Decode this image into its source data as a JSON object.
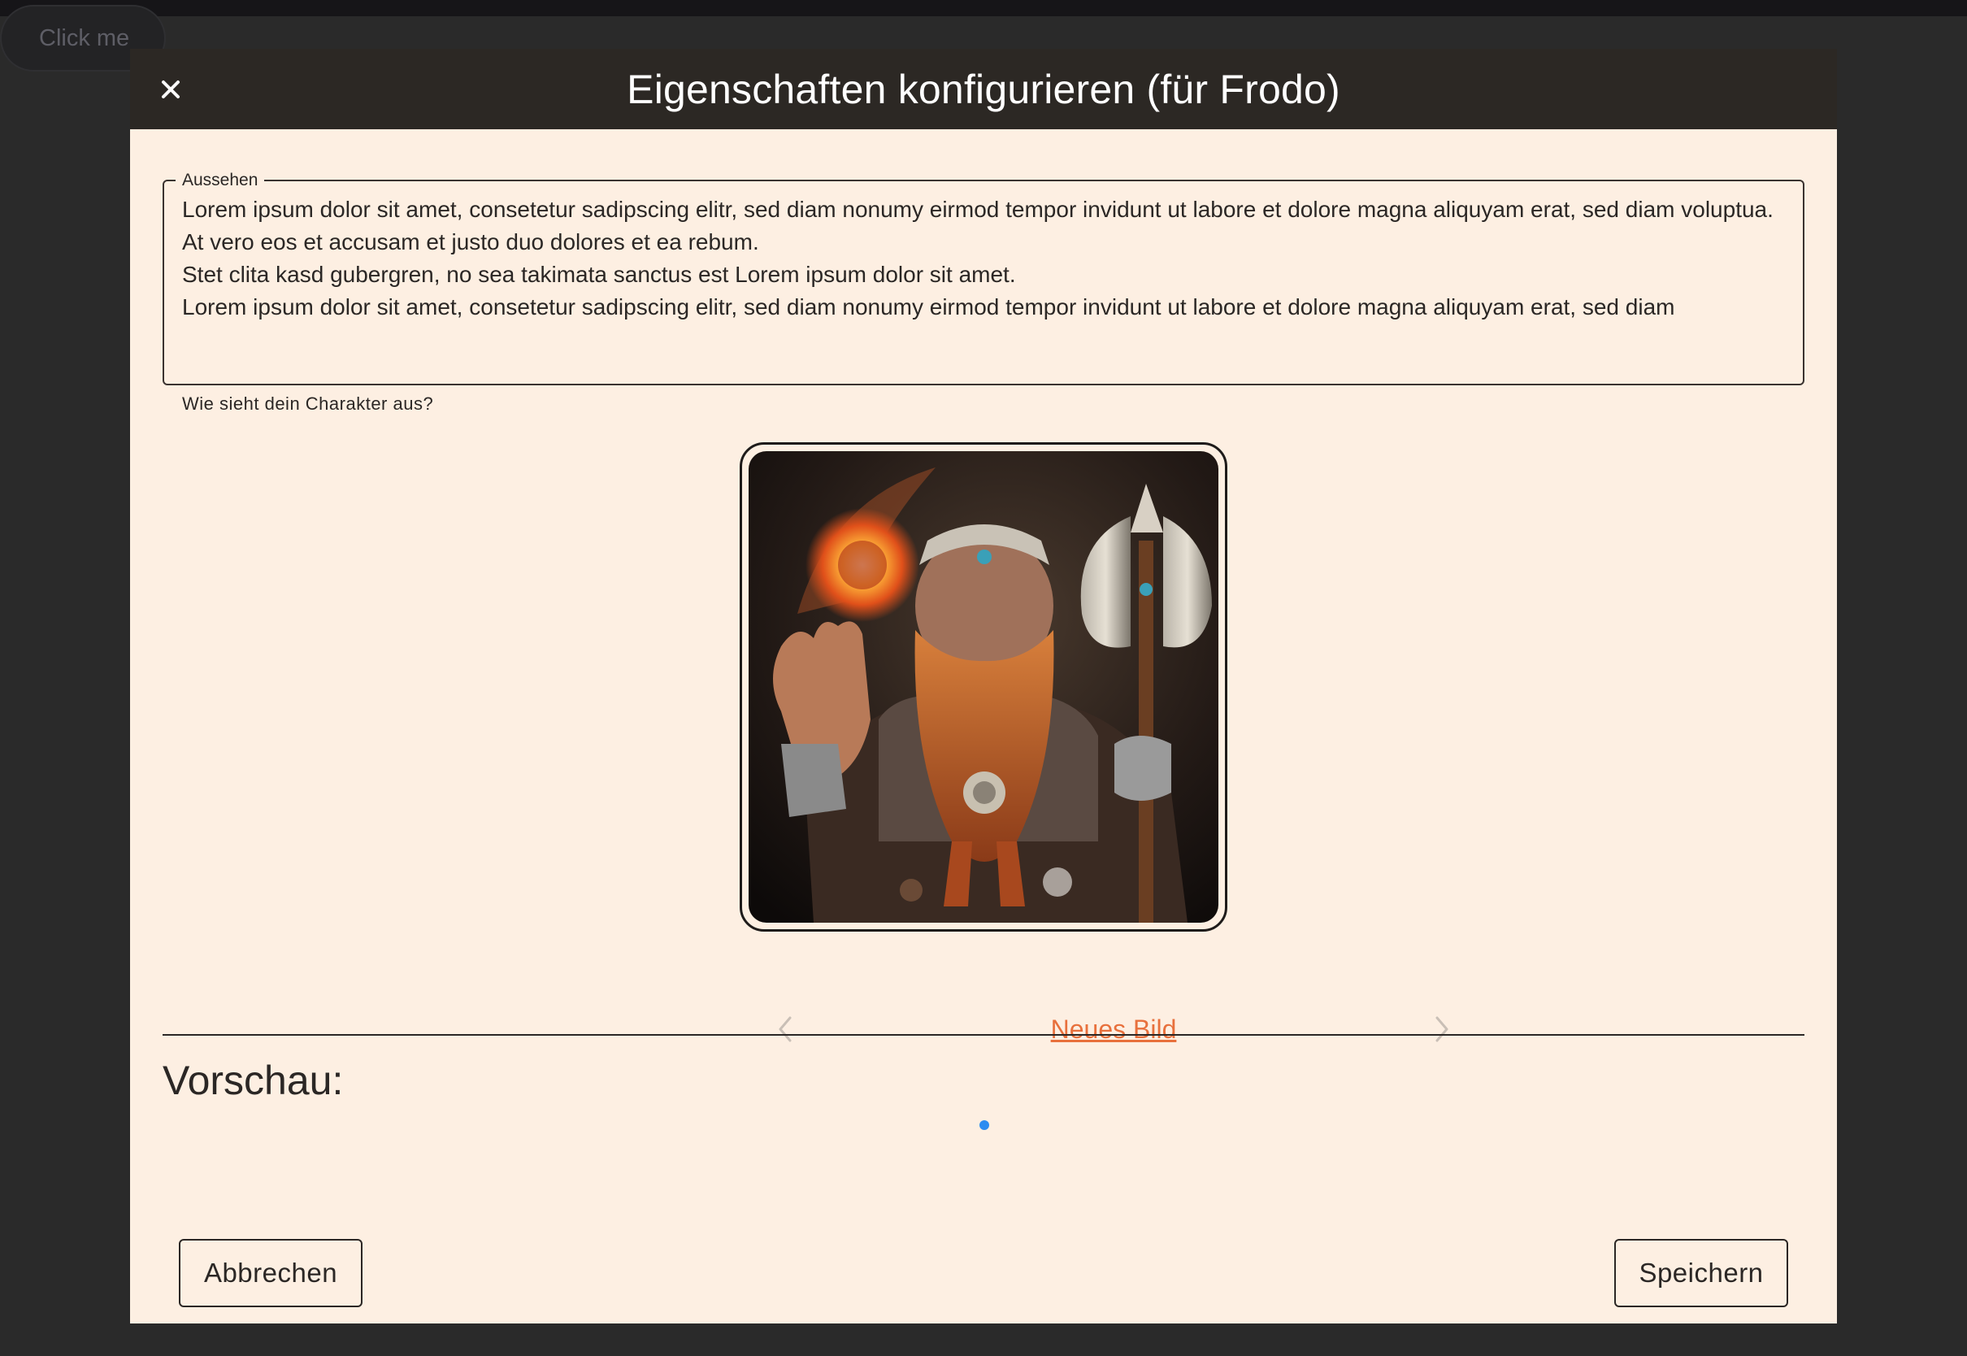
{
  "background": {
    "button_label": "Click me"
  },
  "dialog": {
    "title": "Eigenschaften konfigurieren (für Frodo)",
    "close_symbol": "×",
    "appearance_field": {
      "legend": "Aussehen",
      "value": "Lorem ipsum dolor sit amet, consetetur sadipscing elitr, sed diam nonumy eirmod tempor invidunt ut labore et dolore magna aliquyam erat, sed diam voluptua.\nAt vero eos et accusam et justo duo dolores et ea rebum.\nStet clita kasd gubergren, no sea takimata sanctus est Lorem ipsum dolor sit amet.\nLorem ipsum dolor sit amet, consetetur sadipscing elitr, sed diam nonumy eirmod tempor invidunt ut labore et dolore magna aliquyam erat, sed diam",
      "helper_text": "Wie sieht dein Charakter aus?"
    },
    "image_carousel": {
      "image_subject": "dwarf-warrior-with-axe-and-fireball",
      "prev_icon": "chevron-left-icon",
      "next_icon": "chevron-right-icon",
      "new_image_label": "Neues Bild"
    },
    "preview": {
      "title": "Vorschau:"
    },
    "actions": {
      "cancel_label": "Abbrechen",
      "save_label": "Speichern"
    }
  },
  "colors": {
    "dialog_background": "#fdefe2",
    "header_background": "#2c2824",
    "text": "#2b2725",
    "link": "#e8703c",
    "loading_dot": "#2d8cf0"
  }
}
